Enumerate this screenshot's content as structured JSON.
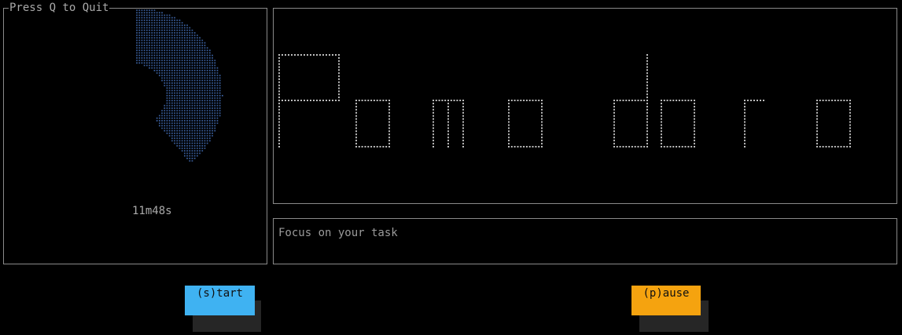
{
  "window": {
    "title": "Press Q to Quit"
  },
  "timer": {
    "remaining": "11m48s",
    "progress_remaining": 0.39
  },
  "banner": {
    "text": "Pomodoro"
  },
  "task": {
    "text": "Focus on your task"
  },
  "buttons": {
    "start_label": "(s)tart",
    "pause_label": "(p)ause"
  },
  "colors": {
    "background": "#000000",
    "border": "#8a8a8a",
    "timer_dots": "#3a5f9e",
    "banner_dots": "#bdbdbd",
    "start_button": "#3fb2f2",
    "pause_button": "#f5a30f"
  }
}
